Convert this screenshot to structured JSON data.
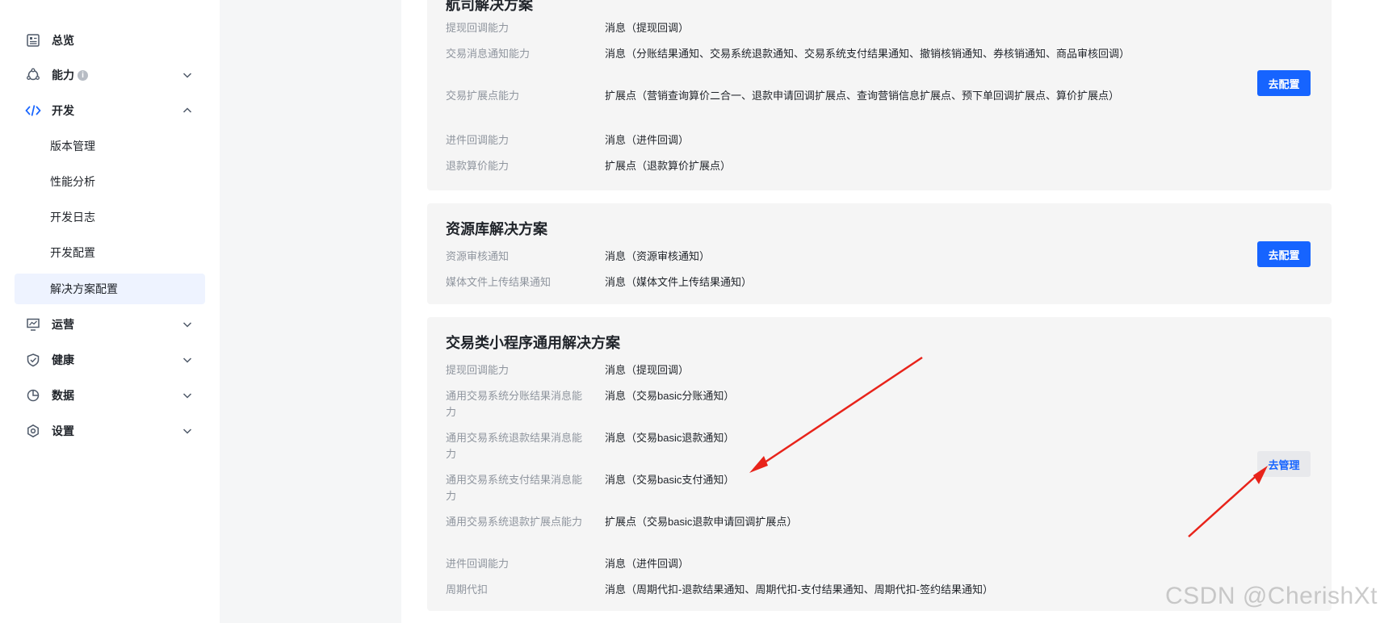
{
  "sidebar": {
    "items": [
      {
        "label": "总览",
        "icon": "overview-icon"
      },
      {
        "label": "能力",
        "icon": "capability-icon"
      },
      {
        "label": "开发",
        "icon": "code-icon"
      },
      {
        "label": "运营",
        "icon": "operations-icon"
      },
      {
        "label": "健康",
        "icon": "health-icon"
      },
      {
        "label": "数据",
        "icon": "data-icon"
      },
      {
        "label": "设置",
        "icon": "settings-icon"
      }
    ],
    "dev_sub": [
      {
        "label": "版本管理"
      },
      {
        "label": "性能分析"
      },
      {
        "label": "开发日志"
      },
      {
        "label": "开发配置"
      },
      {
        "label": "解决方案配置"
      }
    ],
    "info_glyph": "i"
  },
  "cards": [
    {
      "title": "航司解决方案",
      "button": "去配置",
      "rows": [
        {
          "label": "提现回调能力",
          "value": "消息（提现回调）"
        },
        {
          "label": "交易消息通知能力",
          "value": "消息（分账结果通知、交易系统退款通知、交易系统支付结果通知、撤销核销通知、券核销通知、商品审核回调）"
        },
        {
          "label": "交易扩展点能力",
          "value": "扩展点（营销查询算价二合一、退款申请回调扩展点、查询营销信息扩展点、预下单回调扩展点、算价扩展点）"
        },
        {
          "label": "进件回调能力",
          "value": "消息（进件回调）"
        },
        {
          "label": "退款算价能力",
          "value": "扩展点（退款算价扩展点）"
        }
      ]
    },
    {
      "title": "资源库解决方案",
      "button": "去配置",
      "rows": [
        {
          "label": "资源审核通知",
          "value": "消息（资源审核通知）"
        },
        {
          "label": "媒体文件上传结果通知",
          "value": "消息（媒体文件上传结果通知）"
        }
      ]
    },
    {
      "title": "交易类小程序通用解决方案",
      "button": "去管理",
      "rows": [
        {
          "label": "提现回调能力",
          "value": "消息（提现回调）"
        },
        {
          "label": "通用交易系统分账结果消息能力",
          "value": "消息（交易basic分账通知）"
        },
        {
          "label": "通用交易系统退款结果消息能力",
          "value": "消息（交易basic退款通知）"
        },
        {
          "label": "通用交易系统支付结果消息能力",
          "value": "消息（交易basic支付通知）"
        },
        {
          "label": "通用交易系统退款扩展点能力",
          "value": "扩展点（交易basic退款申请回调扩展点）"
        },
        {
          "label": "进件回调能力",
          "value": "消息（进件回调）"
        },
        {
          "label": "周期代扣",
          "value": "消息（周期代扣-退款结果通知、周期代扣-支付结果通知、周期代扣-签约结果通知）"
        }
      ]
    }
  ],
  "watermark": "CSDN @CherishXt",
  "colors": {
    "primary": "#1664ff",
    "active_bg": "#eef3ff",
    "card_bg": "#f5f5f5",
    "label": "#8f959e",
    "arrow": "#e8231a"
  }
}
